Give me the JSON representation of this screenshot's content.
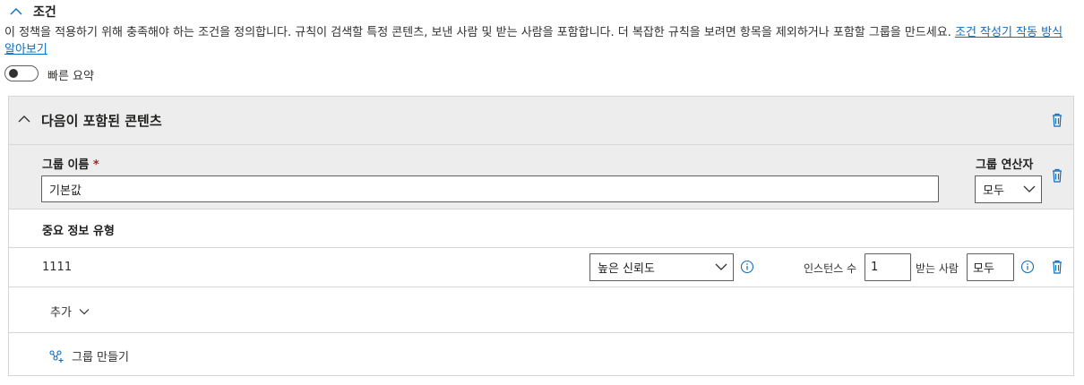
{
  "section": {
    "title": "조건",
    "description": "이 정책을 적용하기 위해 충족해야 하는 조건을 정의합니다. 규칙이 검색할 특정 콘텐츠, 보낸 사람 및 받는 사람을 포함합니다. 더 복잡한 규칙을 보려면 항목을 제외하거나 포함할 그룹을 만드세요.",
    "learn_more_link": "조건 작성기 작동 방식 알아보기"
  },
  "quick_summary": {
    "label": "빠른 요약",
    "enabled": false
  },
  "content_card": {
    "title": "다음이 포함된 콘텐츠",
    "group_name_label": "그룹 이름",
    "required_mark": "*",
    "group_name_value": "기본값",
    "group_operator_label": "그룹 연산자",
    "group_operator_value": "모두",
    "sensitive_info_header": "중요 정보 유형",
    "rows": [
      {
        "name": "1111",
        "confidence": "높은 신뢰도",
        "instance_count_label": "인스턴스 수",
        "instance_count_value": "1",
        "recipient_label": "받는 사람",
        "recipient_value": "모두"
      }
    ],
    "add_label": "추가",
    "create_group_label": "그룹 만들기"
  },
  "colors": {
    "accent": "#0f6cbd",
    "band": "#ededed",
    "border": "#d6d6d6"
  }
}
